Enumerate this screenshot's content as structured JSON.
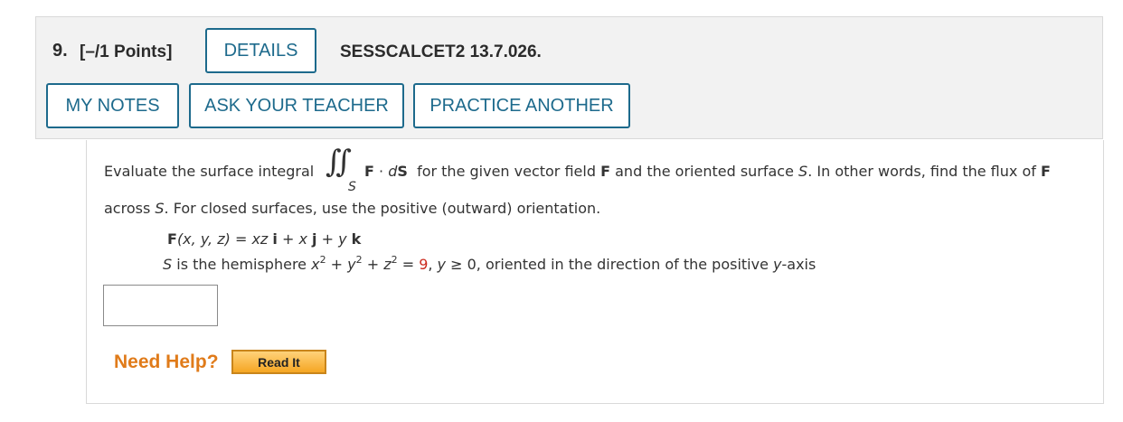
{
  "question": {
    "number": "9.",
    "points": "[–/1 Points]",
    "details_label": "DETAILS",
    "code": "SESSCALCET2 13.7.026."
  },
  "actions": {
    "my_notes": "MY NOTES",
    "ask_teacher": "ASK YOUR TEACHER",
    "practice_another": "PRACTICE ANOTHER"
  },
  "problem": {
    "intro": "Evaluate the surface integral",
    "integral_symbol": "∬",
    "integral_subscript": "S",
    "integrand_F": "F",
    "integrand_dot": " · ",
    "integrand_d": "d",
    "integrand_S": "S",
    "after_integral": "for the given vector field",
    "field_F": "F",
    "and_surface": "and the oriented surface",
    "surface_S": "S",
    "in_other_words": ". In other words, find the flux of",
    "flux_F": "F",
    "across": "across",
    "across_S": "S",
    "closed_note": ". For closed surfaces, use the positive (outward) orientation.",
    "field_def": {
      "F": "F",
      "args": "(x, y, z) = ",
      "c1": "xz",
      "i": "i",
      "plus1": " + ",
      "c2": "x",
      "j": "j",
      "plus2": " + ",
      "c3": "y",
      "k": "k"
    },
    "surface_def": {
      "S": "S",
      "is_the": " is the hemisphere ",
      "x": "x",
      "exp1": "2",
      "plus1": " + ",
      "y": "y",
      "exp2": "2",
      "plus2": " + ",
      "z": "z",
      "exp3": "2",
      "equals": " = ",
      "radius_sq": "9",
      "comma": ", ",
      "y2": "y",
      "cond": " ≥ 0,  oriented in the direction of the positive ",
      "axis": "y",
      "axis_suffix": "-axis"
    }
  },
  "answer": {
    "value": ""
  },
  "help": {
    "need_help": "Need Help?",
    "read_it": "Read It"
  },
  "colors": {
    "accent": "#1d6a8c",
    "help_orange": "#e07b1a",
    "highlight_red": "#cc2a1e"
  }
}
